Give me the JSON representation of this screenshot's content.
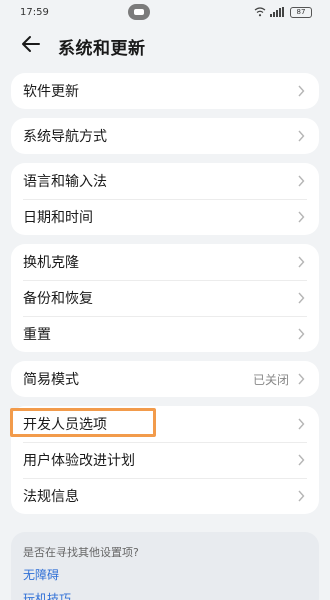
{
  "status_bar": {
    "time": "17:59",
    "battery": "87"
  },
  "header": {
    "title": "系统和更新"
  },
  "groups": [
    {
      "items": [
        {
          "label": "软件更新",
          "value": ""
        }
      ]
    },
    {
      "items": [
        {
          "label": "系统导航方式",
          "value": ""
        }
      ]
    },
    {
      "items": [
        {
          "label": "语言和输入法",
          "value": ""
        },
        {
          "label": "日期和时间",
          "value": ""
        }
      ]
    },
    {
      "items": [
        {
          "label": "换机克隆",
          "value": ""
        },
        {
          "label": "备份和恢复",
          "value": ""
        },
        {
          "label": "重置",
          "value": ""
        }
      ]
    },
    {
      "items": [
        {
          "label": "简易模式",
          "value": "已关闭"
        }
      ]
    },
    {
      "items": [
        {
          "label": "开发人员选项",
          "value": ""
        },
        {
          "label": "用户体验改进计划",
          "value": ""
        },
        {
          "label": "法规信息",
          "value": ""
        }
      ]
    }
  ],
  "suggestions": {
    "title": "是否在寻找其他设置项?",
    "links": [
      "无障碍",
      "玩机技巧"
    ]
  },
  "colors": {
    "highlight": "#f29b4b",
    "link": "#2f6fd6"
  }
}
